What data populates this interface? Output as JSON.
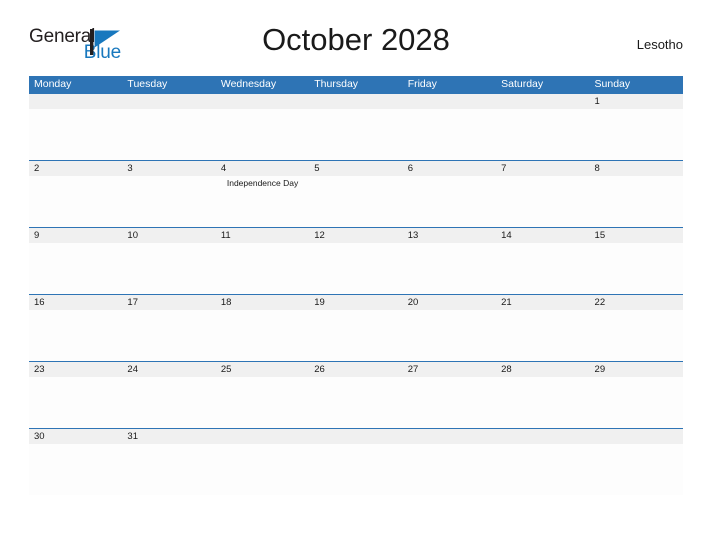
{
  "brand": {
    "name_part1": "General",
    "name_part2": "Blue",
    "flag_icon": "flag-icon",
    "primary_color": "#2e74b5",
    "logo_blue": "#1878be",
    "logo_dark": "#231f20"
  },
  "header": {
    "title": "October 2028",
    "country": "Lesotho"
  },
  "calendar": {
    "weekdays": [
      "Monday",
      "Tuesday",
      "Wednesday",
      "Thursday",
      "Friday",
      "Saturday",
      "Sunday"
    ],
    "weeks": [
      {
        "days": [
          {
            "num": "",
            "event": ""
          },
          {
            "num": "",
            "event": ""
          },
          {
            "num": "",
            "event": ""
          },
          {
            "num": "",
            "event": ""
          },
          {
            "num": "",
            "event": ""
          },
          {
            "num": "",
            "event": ""
          },
          {
            "num": "1",
            "event": ""
          }
        ]
      },
      {
        "days": [
          {
            "num": "2",
            "event": ""
          },
          {
            "num": "3",
            "event": ""
          },
          {
            "num": "4",
            "event": "Independence Day"
          },
          {
            "num": "5",
            "event": ""
          },
          {
            "num": "6",
            "event": ""
          },
          {
            "num": "7",
            "event": ""
          },
          {
            "num": "8",
            "event": ""
          }
        ]
      },
      {
        "days": [
          {
            "num": "9",
            "event": ""
          },
          {
            "num": "10",
            "event": ""
          },
          {
            "num": "11",
            "event": ""
          },
          {
            "num": "12",
            "event": ""
          },
          {
            "num": "13",
            "event": ""
          },
          {
            "num": "14",
            "event": ""
          },
          {
            "num": "15",
            "event": ""
          }
        ]
      },
      {
        "days": [
          {
            "num": "16",
            "event": ""
          },
          {
            "num": "17",
            "event": ""
          },
          {
            "num": "18",
            "event": ""
          },
          {
            "num": "19",
            "event": ""
          },
          {
            "num": "20",
            "event": ""
          },
          {
            "num": "21",
            "event": ""
          },
          {
            "num": "22",
            "event": ""
          }
        ]
      },
      {
        "days": [
          {
            "num": "23",
            "event": ""
          },
          {
            "num": "24",
            "event": ""
          },
          {
            "num": "25",
            "event": ""
          },
          {
            "num": "26",
            "event": ""
          },
          {
            "num": "27",
            "event": ""
          },
          {
            "num": "28",
            "event": ""
          },
          {
            "num": "29",
            "event": ""
          }
        ]
      },
      {
        "days": [
          {
            "num": "30",
            "event": ""
          },
          {
            "num": "31",
            "event": ""
          },
          {
            "num": "",
            "event": ""
          },
          {
            "num": "",
            "event": ""
          },
          {
            "num": "",
            "event": ""
          },
          {
            "num": "",
            "event": ""
          },
          {
            "num": "",
            "event": ""
          }
        ]
      }
    ]
  }
}
